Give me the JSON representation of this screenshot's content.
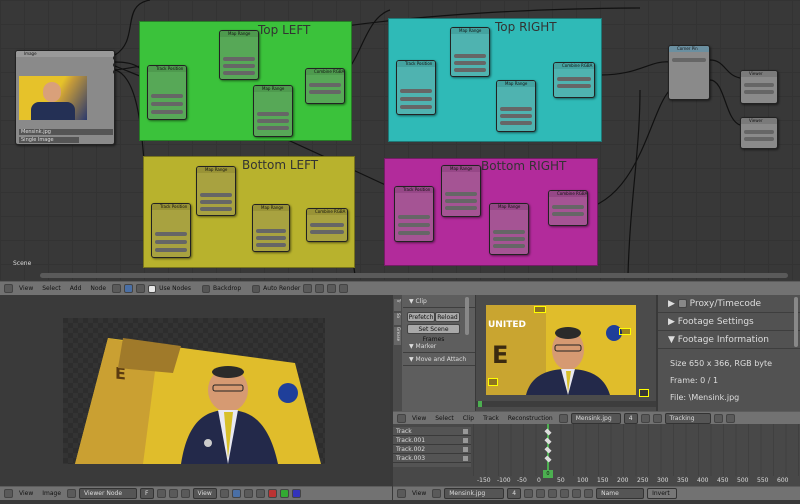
{
  "node_editor": {
    "scene_label": "Scene",
    "frames": [
      {
        "id": "top-left",
        "label": "Top LEFT",
        "color": "#3bc23b"
      },
      {
        "id": "top-right",
        "label": "Top RIGHT",
        "color": "#2fbab7"
      },
      {
        "id": "bottom-left",
        "label": "Bottom LEFT",
        "color": "#b8b22d"
      },
      {
        "id": "bottom-right",
        "label": "Bottom RIGHT",
        "color": "#b22b9b"
      }
    ],
    "image_node": {
      "title": "Image",
      "filename": "Mensink.jpg",
      "source": "Single Image"
    },
    "node_titles": {
      "track_position": "Track Position",
      "map_range": "Map Range",
      "combine_rgba": "Combine RGBA",
      "corner_pin": "Corner Pin",
      "viewer": "Viewer"
    }
  },
  "node_header": {
    "menus": [
      "View",
      "Select",
      "Add",
      "Node"
    ],
    "use_nodes": "Use Nodes",
    "backdrop": "Backdrop",
    "auto_render": "Auto Render"
  },
  "viewer_header": {
    "menus": [
      "View",
      "Image"
    ],
    "image_name": "Viewer Node",
    "f_label": "F",
    "view_label": "View"
  },
  "clip_tools": {
    "tabs": [
      "Tr",
      "So",
      "Grease"
    ],
    "clip_panel": "Clip",
    "prefetch": "Prefetch",
    "reload": "Reload",
    "set_scene_frames": "Set Scene Frames",
    "marker_panel": "Marker",
    "move_attach_panel": "Move and Attach"
  },
  "clip_props": {
    "proxy": "Proxy/Timecode",
    "footage_settings": "Footage Settings",
    "footage_information": "Footage Information",
    "size": "Size 650 x 366, RGB byte",
    "frame": "Frame: 0 / 1",
    "file": "File: \\Mensink.jpg"
  },
  "clip_header": {
    "menus": [
      "View",
      "Select",
      "Clip",
      "Track",
      "Reconstruction"
    ],
    "clip_name": "Mensink.jpg",
    "users": "4",
    "mode": "Tracking"
  },
  "dopesheet": {
    "tracks": [
      "Track",
      "Track.001",
      "Track.002",
      "Track.003"
    ],
    "ticks": [
      "-150",
      "-100",
      "-50",
      "0",
      "50",
      "100",
      "150",
      "200",
      "250",
      "300",
      "350",
      "400",
      "450",
      "500",
      "550",
      "600"
    ],
    "current_frame": "0"
  },
  "bottom_header": {
    "view": "View",
    "clip_name": "Mensink.jpg",
    "users": "4",
    "sort": "Name",
    "invert": "Invert"
  },
  "colors": {
    "frame_green": "#3bc23b",
    "frame_cyan": "#2fbab7",
    "frame_olive": "#b8b22d",
    "frame_magenta": "#b22b9b",
    "socket": "#c7c729"
  }
}
